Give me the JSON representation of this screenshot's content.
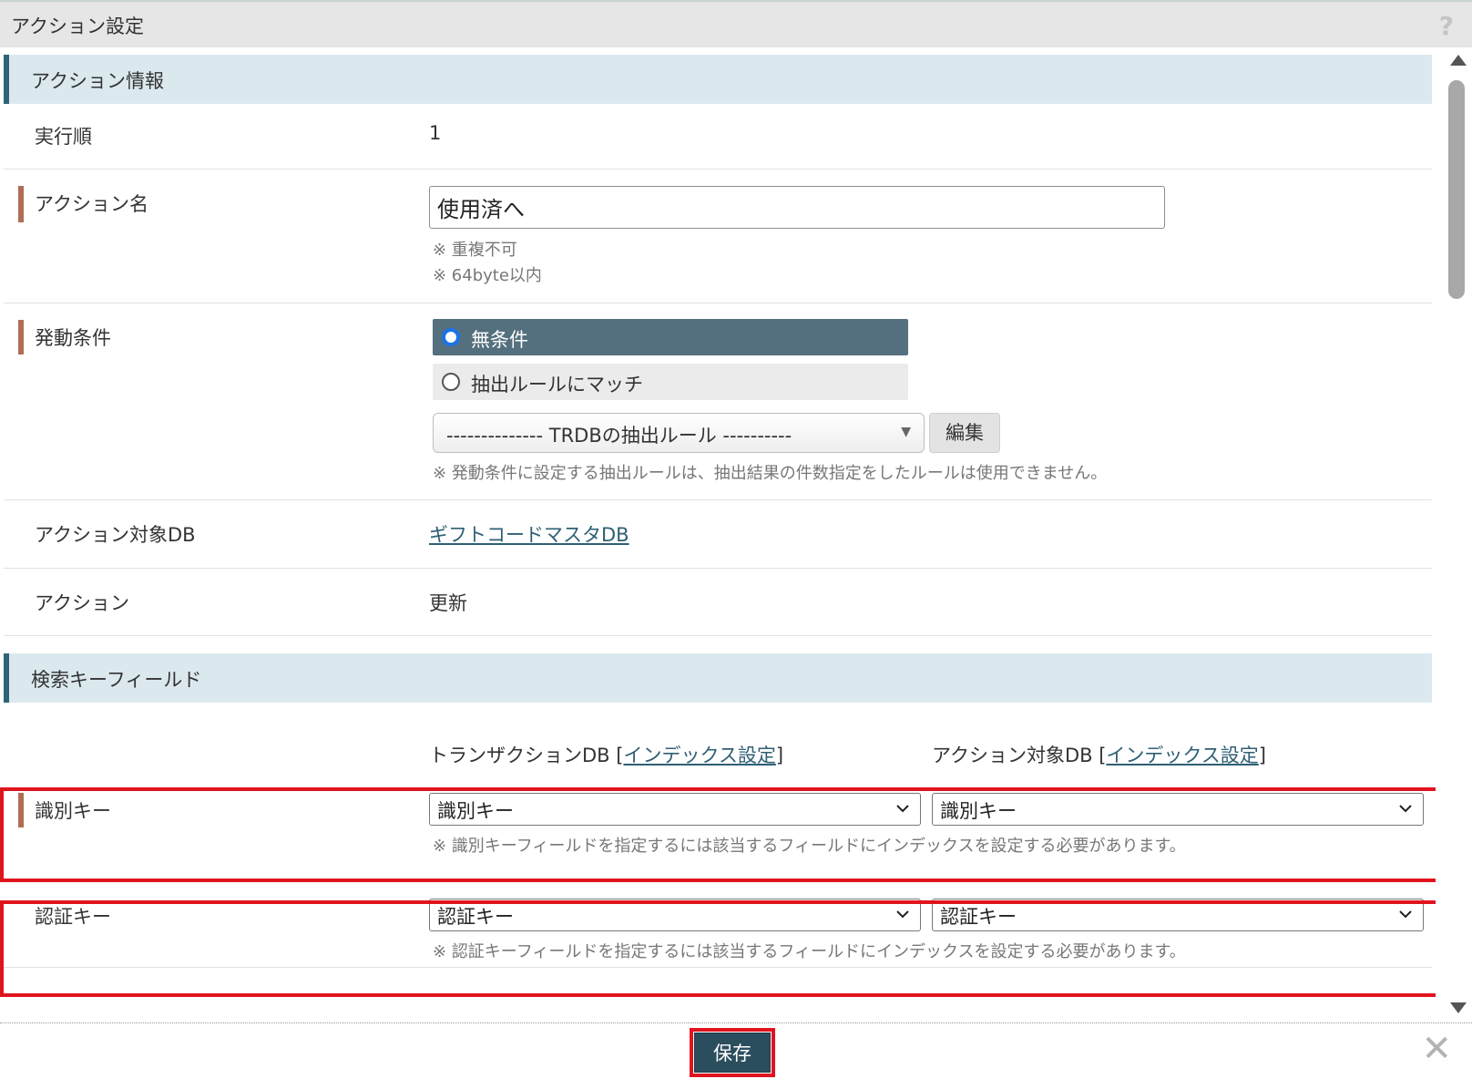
{
  "window": {
    "title": "アクション設定",
    "help_icon": "?"
  },
  "section_action_info": {
    "heading": "アクション情報"
  },
  "exec_order": {
    "label": "実行順",
    "value": "1"
  },
  "action_name": {
    "label": "アクション名",
    "value": "使用済へ",
    "note1": "※ 重複不可",
    "note2": "※ 64byte以内"
  },
  "trigger": {
    "label": "発動条件",
    "option1": "無条件",
    "option2": "抽出ルールにマッチ",
    "rule_select": "-------------- TRDBの抽出ルール ----------",
    "edit_button": "編集",
    "note": "※ 発動条件に設定する抽出ルールは、抽出結果の件数指定をしたルールは使用できません。"
  },
  "target_db": {
    "label": "アクション対象DB",
    "link": "ギフトコードマスタDB"
  },
  "action": {
    "label": "アクション",
    "value": "更新"
  },
  "section_search_key": {
    "heading": "検索キーフィールド"
  },
  "columns": {
    "left_prefix": "トランザクションDB [",
    "left_link": "インデックス設定",
    "left_suffix": "]",
    "right_prefix": "アクション対象DB [",
    "right_link": "インデックス設定",
    "right_suffix": "]"
  },
  "id_key": {
    "label": "識別キー",
    "left_value": "識別キー",
    "right_value": "識別キー",
    "note": "※ 識別キーフィールドを指定するには該当するフィールドにインデックスを設定する必要があります。"
  },
  "auth_key": {
    "label": "認証キー",
    "left_value": "認証キー",
    "right_value": "認証キー",
    "note": "※ 認証キーフィールドを指定するには該当するフィールドにインデックスを設定する必要があります。"
  },
  "footer": {
    "save_button": "保存",
    "close_icon": "✕"
  },
  "colors": {
    "accent": "#2b4e5e",
    "section_bg": "#dbe9ef",
    "required_bar": "#b06d55",
    "highlight": "#e0141e"
  }
}
